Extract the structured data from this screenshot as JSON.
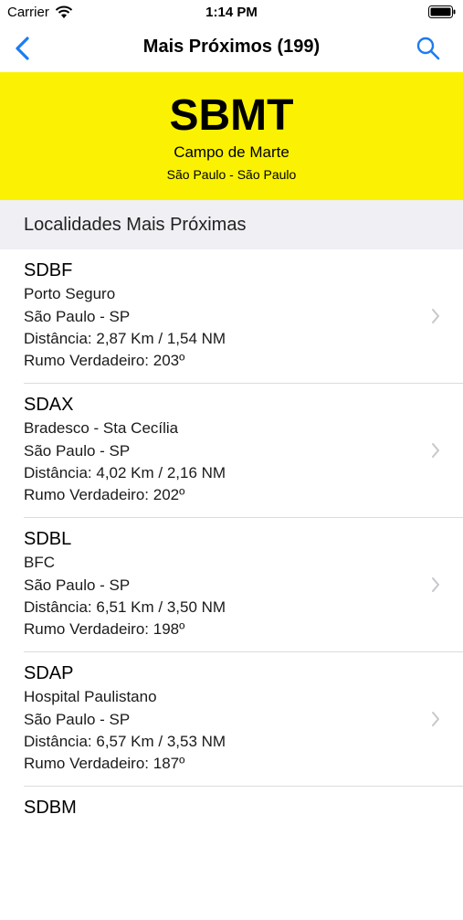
{
  "status_bar": {
    "carrier": "Carrier",
    "time": "1:14 PM"
  },
  "nav": {
    "title": "Mais Próximos (199)",
    "back_icon": "chevron-left-icon",
    "search_icon": "search-icon",
    "accent_color": "#1a7cf5"
  },
  "airport": {
    "code": "SBMT",
    "name": "Campo de Marte",
    "city": "São Paulo - São Paulo",
    "highlight_color": "#fbf203"
  },
  "section": {
    "title": "Localidades Mais Próximas"
  },
  "locations": [
    {
      "code": "SDBF",
      "name": "Porto Seguro",
      "city": "São Paulo - SP",
      "distance": "Distância: 2,87 Km / 1,54 NM",
      "bearing": "Rumo Verdadeiro: 203º"
    },
    {
      "code": "SDAX",
      "name": "Bradesco - Sta Cecília",
      "city": "São Paulo - SP",
      "distance": "Distância: 4,02 Km / 2,16 NM",
      "bearing": "Rumo Verdadeiro: 202º"
    },
    {
      "code": "SDBL",
      "name": "BFC",
      "city": "São Paulo - SP",
      "distance": "Distância: 6,51 Km / 3,50 NM",
      "bearing": "Rumo Verdadeiro: 198º"
    },
    {
      "code": "SDAP",
      "name": "Hospital Paulistano",
      "city": "São Paulo - SP",
      "distance": "Distância: 6,57 Km / 3,53 NM",
      "bearing": "Rumo Verdadeiro: 187º"
    },
    {
      "code": "SDBM"
    }
  ]
}
